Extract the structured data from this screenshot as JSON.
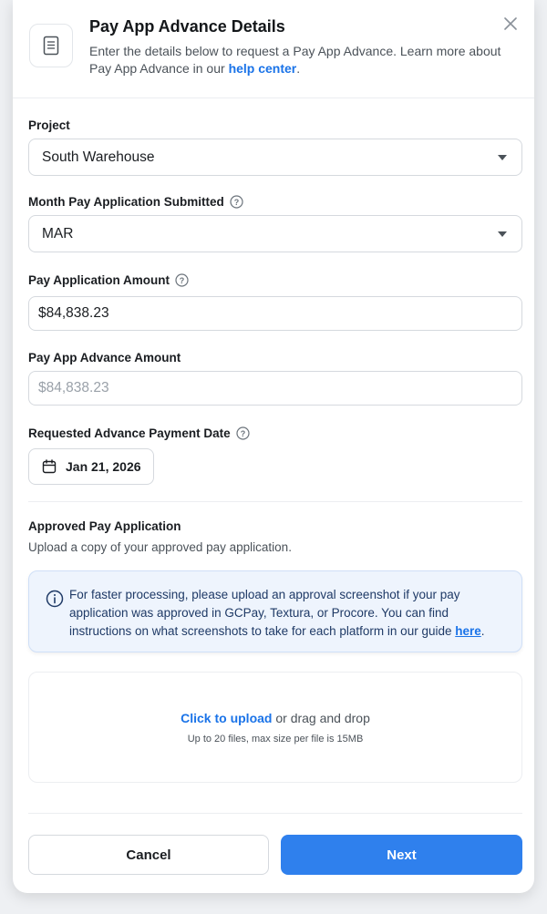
{
  "modal": {
    "title": "Pay App Advance Details",
    "subtitle_pre": "Enter the details below to request a Pay App Advance. Learn more about Pay App Advance in our ",
    "subtitle_link": "help center",
    "subtitle_post": "."
  },
  "fields": {
    "project": {
      "label": "Project",
      "value": "South Warehouse"
    },
    "month": {
      "label": "Month Pay Application Submitted",
      "value": "MAR"
    },
    "amount": {
      "label": "Pay Application Amount",
      "value": "$84,838.23"
    },
    "advance": {
      "label": "Pay App Advance Amount",
      "value": "$84,838.23"
    },
    "date": {
      "label": "Requested Advance Payment Date",
      "value": "Jan 21, 2026"
    }
  },
  "approved": {
    "title": "Approved Pay Application",
    "subtitle": "Upload a copy of your approved pay application.",
    "info_text": "For faster processing, please upload an approval screenshot if your pay application was approved in GCPay, Textura, or Procore. You can find instructions on what screenshots to take for each platform in our guide ",
    "info_link": "here",
    "info_post": "."
  },
  "upload": {
    "link": "Click to upload",
    "text": " or drag and drop",
    "limits": "Up to 20 files, max size per file is 15MB"
  },
  "buttons": {
    "cancel": "Cancel",
    "next": "Next"
  },
  "icons": {
    "header": "document-icon",
    "close": "close-icon",
    "help": "help-circle-icon",
    "calendar": "calendar-icon",
    "info": "info-icon",
    "dropdown": "caret-down-icon"
  },
  "colors": {
    "accent": "#2f80ed",
    "link": "#1a73e8",
    "info_bg": "#eef4fd"
  }
}
